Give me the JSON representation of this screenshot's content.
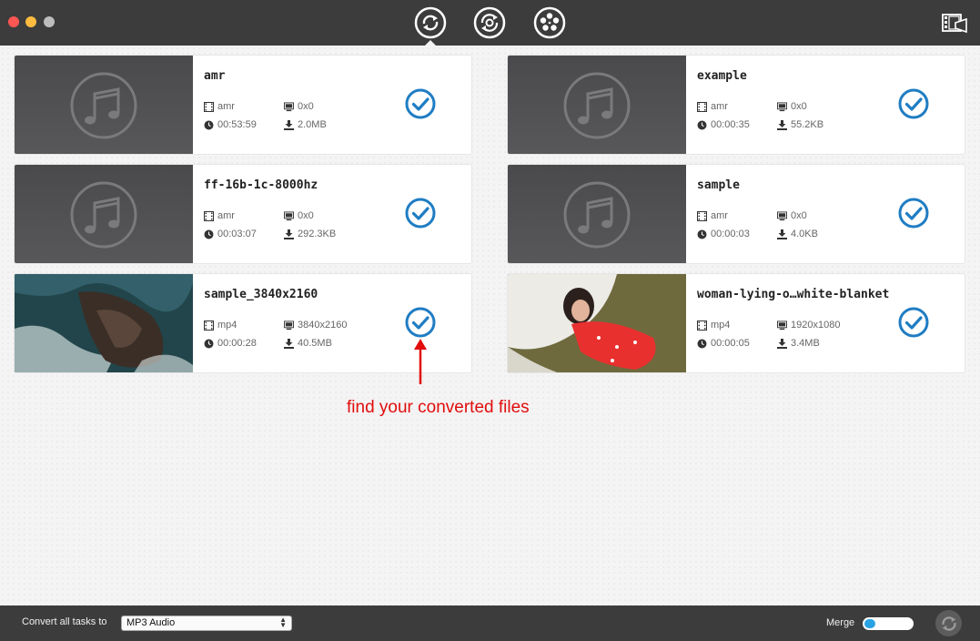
{
  "toolbar": {
    "modes": [
      {
        "name": "convert",
        "icon": "convert-icon",
        "active": true
      },
      {
        "name": "download",
        "icon": "download-convert-icon",
        "active": false
      },
      {
        "name": "burn",
        "icon": "film-reel-icon",
        "active": false
      }
    ],
    "media_browser_icon": "media-browser-icon"
  },
  "files": [
    {
      "name": "amr",
      "format": "amr",
      "resolution": "0x0",
      "duration": "00:53:59",
      "size": "2.0MB",
      "thumb": "music"
    },
    {
      "name": "example",
      "format": "amr",
      "resolution": "0x0",
      "duration": "00:00:35",
      "size": "55.2KB",
      "thumb": "music"
    },
    {
      "name": "ff-16b-1c-8000hz",
      "format": "amr",
      "resolution": "0x0",
      "duration": "00:03:07",
      "size": "292.3KB",
      "thumb": "music"
    },
    {
      "name": "sample",
      "format": "amr",
      "resolution": "0x0",
      "duration": "00:00:03",
      "size": "4.0KB",
      "thumb": "music"
    },
    {
      "name": "sample_3840x2160",
      "format": "mp4",
      "resolution": "3840x2160",
      "duration": "00:00:28",
      "size": "40.5MB",
      "thumb": "sea"
    },
    {
      "name": "woman-lying-o…white-blanket",
      "format": "mp4",
      "resolution": "1920x1080",
      "duration": "00:00:05",
      "size": "3.4MB",
      "thumb": "woman"
    }
  ],
  "annotation": {
    "text": "find your converted files",
    "color": "#e10d0d"
  },
  "bottombar": {
    "convert_label": "Convert all tasks to",
    "format_value": "MP3 Audio",
    "merge_label": "Merge",
    "merge_on": false
  },
  "colors": {
    "accent": "#1f7dc3",
    "titlebar": "#3c3c3c"
  }
}
